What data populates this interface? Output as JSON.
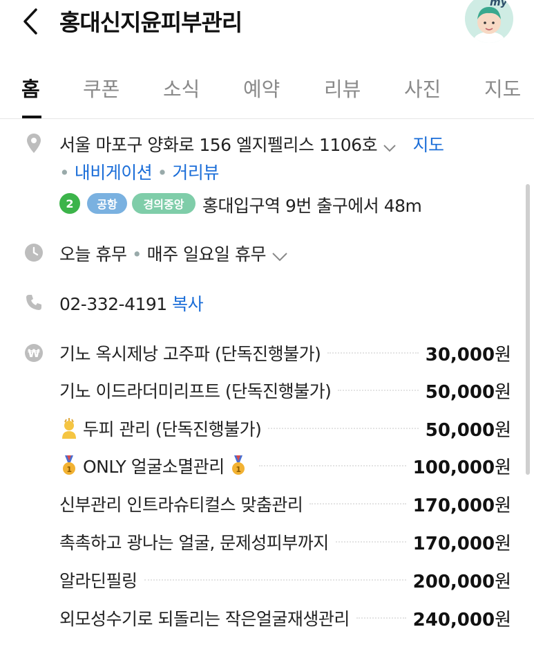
{
  "header": {
    "title": "홍대신지윤피부관리",
    "avatar_text": "my"
  },
  "tabs": [
    {
      "label": "홈",
      "active": true
    },
    {
      "label": "쿠폰"
    },
    {
      "label": "소식"
    },
    {
      "label": "예약"
    },
    {
      "label": "리뷰"
    },
    {
      "label": "사진"
    },
    {
      "label": "지도"
    }
  ],
  "address": {
    "text": "서울 마포구 양화로 156 엘지펠리스 1106호",
    "map_link": "지도",
    "nav_link": "내비게이션",
    "street_link": "거리뷰"
  },
  "transit": {
    "line_number": "2",
    "badge_airport": "공항",
    "badge_gyeongui": "경의중앙",
    "direction": "홍대입구역 9번 출구에서 48m",
    "colors": {
      "line2": "#3cb44a",
      "airport": "#7ab1e0",
      "gyeongui": "#7fcda9"
    }
  },
  "hours": {
    "today": "오늘 휴무",
    "regular": "매주 일요일 휴무"
  },
  "phone": {
    "number": "02-332-4191",
    "copy_label": "복사"
  },
  "menu": {
    "currency": "원",
    "items": [
      {
        "name": "기노 옥시제낭 고주파 (단독진행불가)",
        "price": "30,000"
      },
      {
        "name": "기노 이드라더미리프트 (단독진행불가)",
        "price": "50,000"
      },
      {
        "name": "두피 관리 (단독진행불가)",
        "price": "50,000",
        "icon": "massage-icon"
      },
      {
        "name": "ONLY 얼굴소멸관리",
        "price": "100,000",
        "icon": "medal-icon"
      },
      {
        "name": "신부관리 인트라슈티컬스 맞춤관리",
        "price": "170,000"
      },
      {
        "name": "촉촉하고 광나는 얼굴, 문제성피부까지",
        "price": "170,000"
      },
      {
        "name": "알라딘필링",
        "price": "200,000"
      },
      {
        "name": "외모성수기로 되돌리는 작은얼굴재생관리",
        "price": "240,000"
      }
    ]
  }
}
